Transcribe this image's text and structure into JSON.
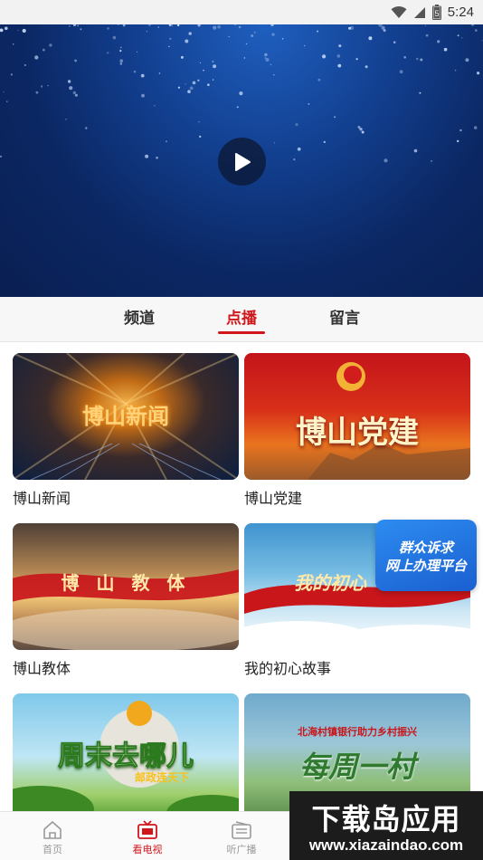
{
  "status_bar": {
    "time": "5:24",
    "battery_level": "5"
  },
  "video": {
    "play_icon": "play-icon"
  },
  "tabs": [
    {
      "label": "频道",
      "active": false
    },
    {
      "label": "点播",
      "active": true
    },
    {
      "label": "留言",
      "active": false
    }
  ],
  "cards": [
    {
      "title": "博山新闻",
      "thumb_text": "博山新闻"
    },
    {
      "title": "博山党建",
      "thumb_text": "博山党建"
    },
    {
      "title": "博山教体",
      "thumb_text": "博 山 教 体"
    },
    {
      "title": "我的初心故事",
      "thumb_text": "我的初心"
    },
    {
      "title": "",
      "thumb_text": "周末去哪儿",
      "thumb_subtext": "邮政连天下"
    },
    {
      "title": "",
      "thumb_text": "每周一村",
      "thumb_subtext": "北海村镇银行助力乡村振兴"
    }
  ],
  "badge": {
    "line1": "群众诉求",
    "line2": "网上办理平台"
  },
  "bottom_nav": [
    {
      "label": "首页",
      "icon": "home-icon",
      "active": false
    },
    {
      "label": "看电视",
      "icon": "tv-icon",
      "active": true
    },
    {
      "label": "听广播",
      "icon": "radio-icon",
      "active": false
    }
  ],
  "watermark": {
    "main": "下载岛应用",
    "url": "www.xiazaindao.com"
  },
  "colors": {
    "accent": "#d0161b",
    "badge": "#2d8cf0"
  }
}
